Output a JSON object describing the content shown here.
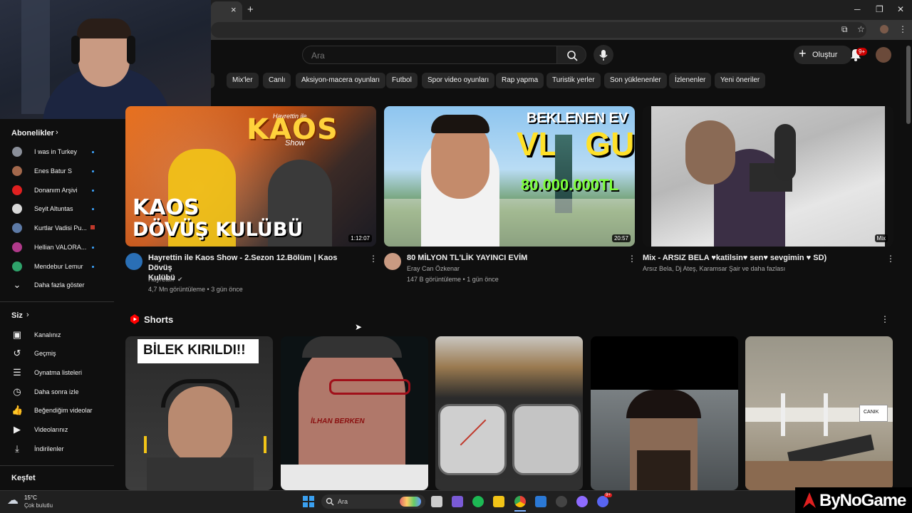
{
  "browser": {
    "tab_close": "×",
    "new_tab": "+",
    "window_min": "─",
    "window_max": "❐",
    "window_close": "✕"
  },
  "search": {
    "placeholder": "Ara"
  },
  "header": {
    "create_label": "Oluştur",
    "notif_count": "9+"
  },
  "chips": [
    "ik",
    "Mix'ler",
    "Canlı",
    "Aksiyon-macera oyunları",
    "Futbol",
    "Spor video oyunları",
    "Rap yapma",
    "Turistik yerler",
    "Son yüklenenler",
    "İzlenenler",
    "Yeni öneriler"
  ],
  "sidebar": {
    "subs_title": "Abonelikler",
    "subs": [
      "I was in Turkey",
      "Enes Batur S",
      "Donanım Arşivi",
      "Seyit Altuntas",
      "Kurtlar Vadisi Pu...",
      "Hellian VALORA...",
      "Mendebur Lemur"
    ],
    "show_more": "Daha fazla göster",
    "you_title": "Siz",
    "you_items": [
      "Kanalınız",
      "Geçmiş",
      "Oynatma listeleri",
      "Daha sonra izle",
      "Beğendiğim videolar",
      "Videolarınız",
      "İndirilenler"
    ],
    "explore_title": "Keşfet"
  },
  "videos": [
    {
      "title_line1": "Hayrettin ile Kaos Show - 2.Sezon 12.Bölüm | Kaos Dövüş",
      "title_line2": "Kulübü",
      "channel": "Hayrettin",
      "stats": "4,7 Mn görüntüleme • 3 gün önce",
      "duration": "1:12:07",
      "thumb_text1": "KAOS",
      "thumb_text2": "DÖVÜŞ KULÜBÜ",
      "thumb_brand": "KAOS",
      "thumb_brand_sub": "Show",
      "thumb_brand_top": "Hayrettin ile"
    },
    {
      "title_line1": "80 MİLYON TL'LİK YAYINCI EVİM",
      "channel": "Eray Can Özkenar",
      "stats": "147 B görüntüleme • 1 gün önce",
      "duration": "20:57",
      "thumb_text1": "BEKLENEN EV",
      "thumb_text2": "VL   GU",
      "thumb_price": "80.000.000TL"
    },
    {
      "title_line1": "Mix - ARSIZ BELA ♥katilsin♥ sen♥ sevgimin ♥ SD)",
      "channel": "Arsız Bela, Dj Ateş, Karamsar Şair ve daha fazlası",
      "duration": "Mix"
    }
  ],
  "shorts": {
    "title": "Shorts",
    "card1_text": "BİLEK KIRILDI!!",
    "card2_text": "İLHAN BERKEN",
    "card5_text": "CANIK"
  },
  "taskbar": {
    "weather_temp": "15°C",
    "weather_desc": "Çok bulutlu",
    "search": "Ara",
    "badge": "9+"
  },
  "overlay_logo": "ByNoGame",
  "colors": {
    "bg": "#0f0f0f",
    "accent_red": "#ff0000",
    "link_blue": "#3ea6ff"
  }
}
